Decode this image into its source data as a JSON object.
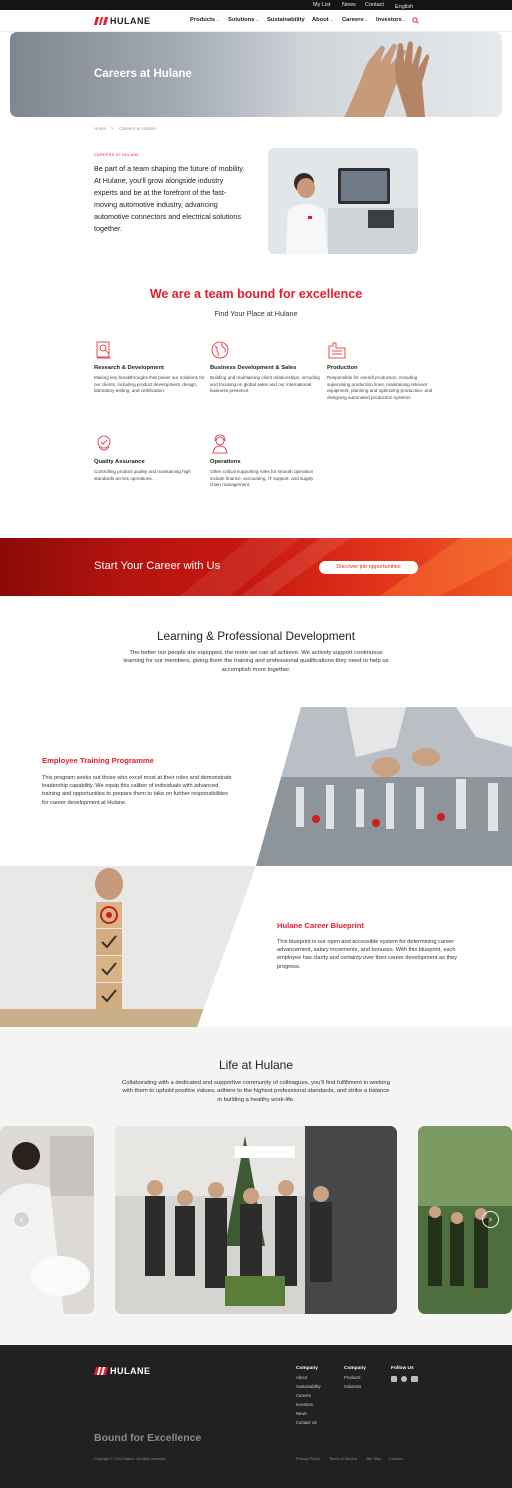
{
  "topbar": {
    "links": [
      "My List",
      "News",
      "Contact"
    ],
    "language": "English"
  },
  "header": {
    "logo_text": "HULANE",
    "nav": [
      "Products",
      "Solutions",
      "Sustainability",
      "About",
      "Careers",
      "Investors"
    ]
  },
  "hero": {
    "title": "Careers at Hulane"
  },
  "breadcrumb": {
    "home": "Home",
    "sep": ">",
    "current": "Careers at Hulane"
  },
  "intro": {
    "eyebrow": "CAREERS AT HULANE",
    "text": "Be part of a team shaping the future of mobility. At Hulane, you'll grow alongside industry experts and be at the forefront of the fast-moving automotive industry, advancing automotive connectors and electrical solutions together."
  },
  "team": {
    "title": "We are a team bound for excellence",
    "subtitle": "Find Your Place at Hulane",
    "roles": [
      {
        "title": "Research & Development",
        "icon": "rd-document-icon",
        "text": "Making key breakthroughs that power our solutions for our clients, including product development, design, laboratory testing, and certification."
      },
      {
        "title": "Business Development & Sales",
        "icon": "globe-icon",
        "text": "Building and maintaining client relationships, including and focusing on global sales and our international business presence."
      },
      {
        "title": "Production",
        "icon": "factory-icon",
        "text": "Responsible for overall production, including supervising production lines, maintaining relevant equipment, planning and optimizing production, and designing automated production systems."
      },
      {
        "title": "Quality Assurance",
        "icon": "quality-badge-icon",
        "text": "Controlling product quality and maintaining high standards across operations."
      },
      {
        "title": "Operations",
        "icon": "operator-headset-icon",
        "text": "Other critical supporting roles for smooth operation include finance, accounting, IT support, and supply chain management."
      }
    ]
  },
  "cta": {
    "title": "Start Your Career with Us",
    "button": "Discover job opportunities"
  },
  "learning": {
    "title": "Learning & Professional Development",
    "text": "The better our people are equipped, the more we can all achieve. We actively support continuous learning for our members, giving them the training and professional qualifications they need to help us accomplish more together."
  },
  "training": {
    "title": "Employee Training Programme",
    "text": "This program seeks out those who excel most at their roles and demonstrate leadership capability. We equip this caliber of individuals with advanced training and opportunities to prepare them to take on further responsibilities for career development at Hulane."
  },
  "blueprint": {
    "title": "Hulane Career Blueprint",
    "text": "This blueprint is our open and accessible system for determining career advancement, salary increments, and bonuses. With this blueprint, each employee has clarity and certainty over their career development as they progress."
  },
  "life": {
    "title": "Life at Hulane",
    "text": "Collaborating with a dedicated and supportive community of colleagues, you'll find fulfillment in working with them to uphold positive values, adhere to the highest professional standards, and strike a balance in building a healthy work-life."
  },
  "footer": {
    "logo_text": "HULANE",
    "company": {
      "heading": "Company",
      "links": [
        "About",
        "Sustainability",
        "Careers",
        "Investors",
        "News",
        "Contact Us"
      ]
    },
    "category": {
      "heading": "Company",
      "links": [
        "Products",
        "Solutions"
      ]
    },
    "follow": {
      "heading": "Follow Us",
      "icons": [
        "linkedin-icon",
        "wechat-icon",
        "youtube-icon"
      ]
    },
    "tagline": "Bound for Excellence",
    "copyright": "Copyright © 2024 Hulane. All rights reserved.",
    "legal": [
      "Privacy Policy",
      "Terms of Service",
      "Site Map",
      "Cookies"
    ]
  },
  "colors": {
    "brand": "#e51d2b",
    "footer": "#212121",
    "topbar": "#141414"
  }
}
